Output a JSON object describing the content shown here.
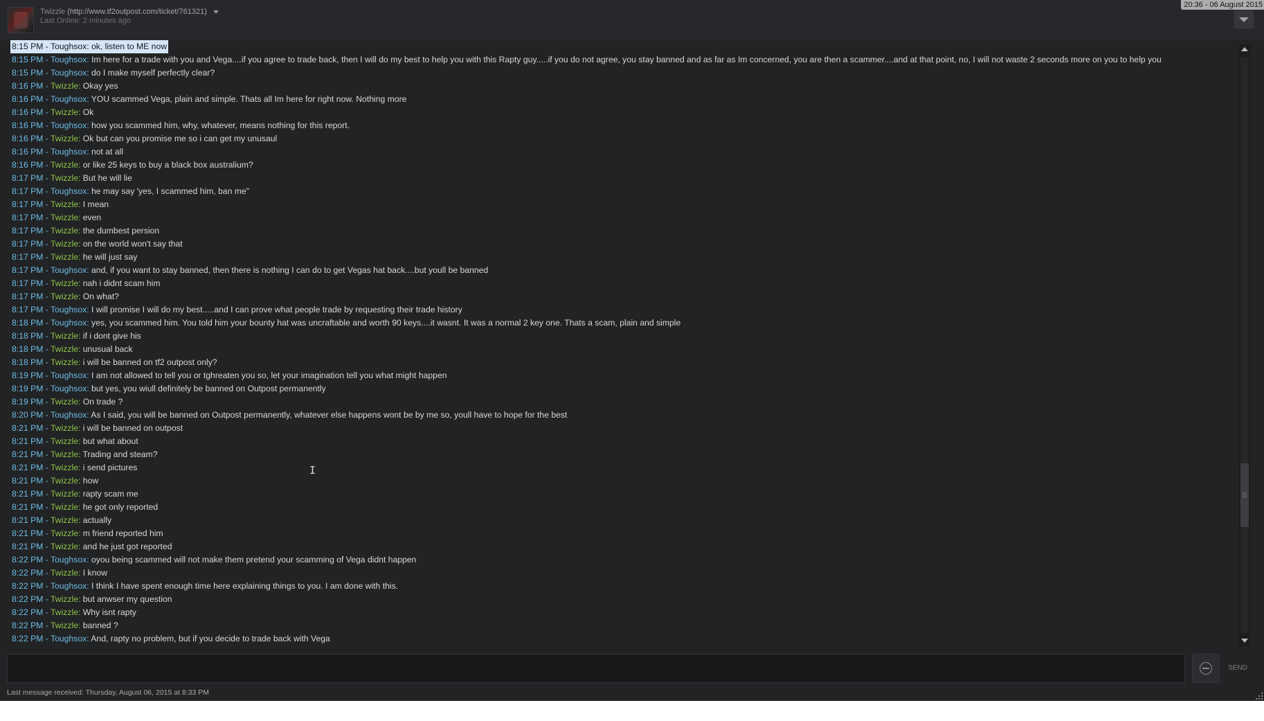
{
  "header": {
    "name": "Twizzle",
    "url": "(http://www.tf2outpost.com/ticket/761321)",
    "last_online": "Last Online: 2 minutes ago",
    "clock": "20:36 - 06 August 2015"
  },
  "messages": [
    {
      "time": "8:15 PM",
      "sender": "Toughsox",
      "text": "ok, listen to ME now",
      "selected": true
    },
    {
      "time": "8:15 PM",
      "sender": "Toughsox",
      "text": "Im here for a trade with you and Vega....if you agree to trade back, then I will do my best to help you with this Rapty guy.....if you do not agree, you stay banned and as far as Im concerned, you are then a scammer....and at that point, no, I will not waste 2 seconds more on you to help you"
    },
    {
      "time": "8:15 PM",
      "sender": "Toughsox",
      "text": "do I make myself perfectly clear?"
    },
    {
      "time": "8:16 PM",
      "sender": "Twizzle",
      "text": "Okay yes"
    },
    {
      "time": "8:16 PM",
      "sender": "Toughsox",
      "text": "YOU scammed Vega, plain and simple. Thats all Im here for right now. Nothing more"
    },
    {
      "time": "8:16 PM",
      "sender": "Twizzle",
      "text": "Ok"
    },
    {
      "time": "8:16 PM",
      "sender": "Toughsox",
      "text": "how you scammed him, why, whatever, means nothing for this report."
    },
    {
      "time": "8:16 PM",
      "sender": "Twizzle",
      "text": "Ok but can you promise me so i can get my unusaul"
    },
    {
      "time": "8:16 PM",
      "sender": "Toughsox",
      "text": "not at all"
    },
    {
      "time": "8:16 PM",
      "sender": "Twizzle",
      "text": "or like 25 keys to buy a black box australium?"
    },
    {
      "time": "8:17 PM",
      "sender": "Twizzle",
      "text": "But he will lie"
    },
    {
      "time": "8:17 PM",
      "sender": "Toughsox",
      "text": "he may say 'yes, I scammed him, ban me\""
    },
    {
      "time": "8:17 PM",
      "sender": "Twizzle",
      "text": "I mean"
    },
    {
      "time": "8:17 PM",
      "sender": "Twizzle",
      "text": "even"
    },
    {
      "time": "8:17 PM",
      "sender": "Twizzle",
      "text": "the  dumbest persion"
    },
    {
      "time": "8:17 PM",
      "sender": "Twizzle",
      "text": "on the world won't say that"
    },
    {
      "time": "8:17 PM",
      "sender": "Twizzle",
      "text": "he will just say"
    },
    {
      "time": "8:17 PM",
      "sender": "Toughsox",
      "text": "and, if you want to stay banned, then there is nothing I can do to get Vegas hat back....but youll be banned"
    },
    {
      "time": "8:17 PM",
      "sender": "Twizzle",
      "text": "nah i didnt scam him"
    },
    {
      "time": "8:17 PM",
      "sender": "Twizzle",
      "text": "On what?"
    },
    {
      "time": "8:17 PM",
      "sender": "Toughsox",
      "text": "I will promise I will do my best.....and I can prove what people trade by requesting their trade history"
    },
    {
      "time": "8:18 PM",
      "sender": "Toughsox",
      "text": "yes, you scammed him. You told him your bounty hat was uncraftable and worth 90 keys....it wasnt. It was a normal 2 key one. Thats a scam, plain and simple"
    },
    {
      "time": "8:18 PM",
      "sender": "Twizzle",
      "text": "if i dont give his"
    },
    {
      "time": "8:18 PM",
      "sender": "Twizzle",
      "text": "unusual back"
    },
    {
      "time": "8:18 PM",
      "sender": "Twizzle",
      "text": "i will be  banned on tf2 outpost only?"
    },
    {
      "time": "8:19 PM",
      "sender": "Toughsox",
      "text": "I am not allowed to tell you or tghreaten you so, let your imagination tell you what might happen"
    },
    {
      "time": "8:19 PM",
      "sender": "Toughsox",
      "text": "but yes, you wiull definitely be banned on Outpost permanently"
    },
    {
      "time": "8:19 PM",
      "sender": "Twizzle",
      "text": "On trade ?"
    },
    {
      "time": "8:20 PM",
      "sender": "Toughsox",
      "text": "As I said, you will be banned on Outpost permanently, whatever else happens wont be by me so, youll have to hope for the best"
    },
    {
      "time": "8:21 PM",
      "sender": "Twizzle",
      "text": "i will be banned on outpost"
    },
    {
      "time": "8:21 PM",
      "sender": "Twizzle",
      "text": "but what about"
    },
    {
      "time": "8:21 PM",
      "sender": "Twizzle",
      "text": "Trading and steam?"
    },
    {
      "time": "8:21 PM",
      "sender": "Twizzle",
      "text": "i send pictures"
    },
    {
      "time": "8:21 PM",
      "sender": "Twizzle",
      "text": "how"
    },
    {
      "time": "8:21 PM",
      "sender": "Twizzle",
      "text": "rapty scam me"
    },
    {
      "time": "8:21 PM",
      "sender": "Twizzle",
      "text": "he got only reported"
    },
    {
      "time": "8:21 PM",
      "sender": "Twizzle",
      "text": "actually"
    },
    {
      "time": "8:21 PM",
      "sender": "Twizzle",
      "text": "m friend reported him"
    },
    {
      "time": "8:21 PM",
      "sender": "Twizzle",
      "text": "and he just got reported"
    },
    {
      "time": "8:22 PM",
      "sender": "Toughsox",
      "text": "oyou being scammed will not make them pretend your scamming of Vega didnt happen"
    },
    {
      "time": "8:22 PM",
      "sender": "Twizzle",
      "text": "I know"
    },
    {
      "time": "8:22 PM",
      "sender": "Toughsox",
      "text": "I think I have spent enough time here explaining things to you.  I am done with this."
    },
    {
      "time": "8:22 PM",
      "sender": "Twizzle",
      "text": "but anwser my question"
    },
    {
      "time": "8:22 PM",
      "sender": "Twizzle",
      "text": "Why isnt rapty"
    },
    {
      "time": "8:22 PM",
      "sender": "Twizzle",
      "text": "banned ?"
    },
    {
      "time": "8:22 PM",
      "sender": "Toughsox",
      "text": "And, rapty no problem, but if you decide to trade back with Vega"
    }
  ],
  "input": {
    "send_label": "SEND"
  },
  "footer": {
    "last_received": "Last message received: Thursday, August 06, 2015 at 8:33 PM"
  },
  "colors": {
    "timestamp": "#6dbce5",
    "sender_toughsox": "#6dbce5",
    "sender_twizzle": "#8fc34a",
    "message_text": "#d8d8d8",
    "background": "#222325"
  },
  "icons": [
    "dropdown-caret-icon",
    "menu-dropdown-icon",
    "scroll-up-icon",
    "scroll-down-icon",
    "emoticon-icon",
    "text-cursor-icon",
    "resize-grip-icon"
  ]
}
